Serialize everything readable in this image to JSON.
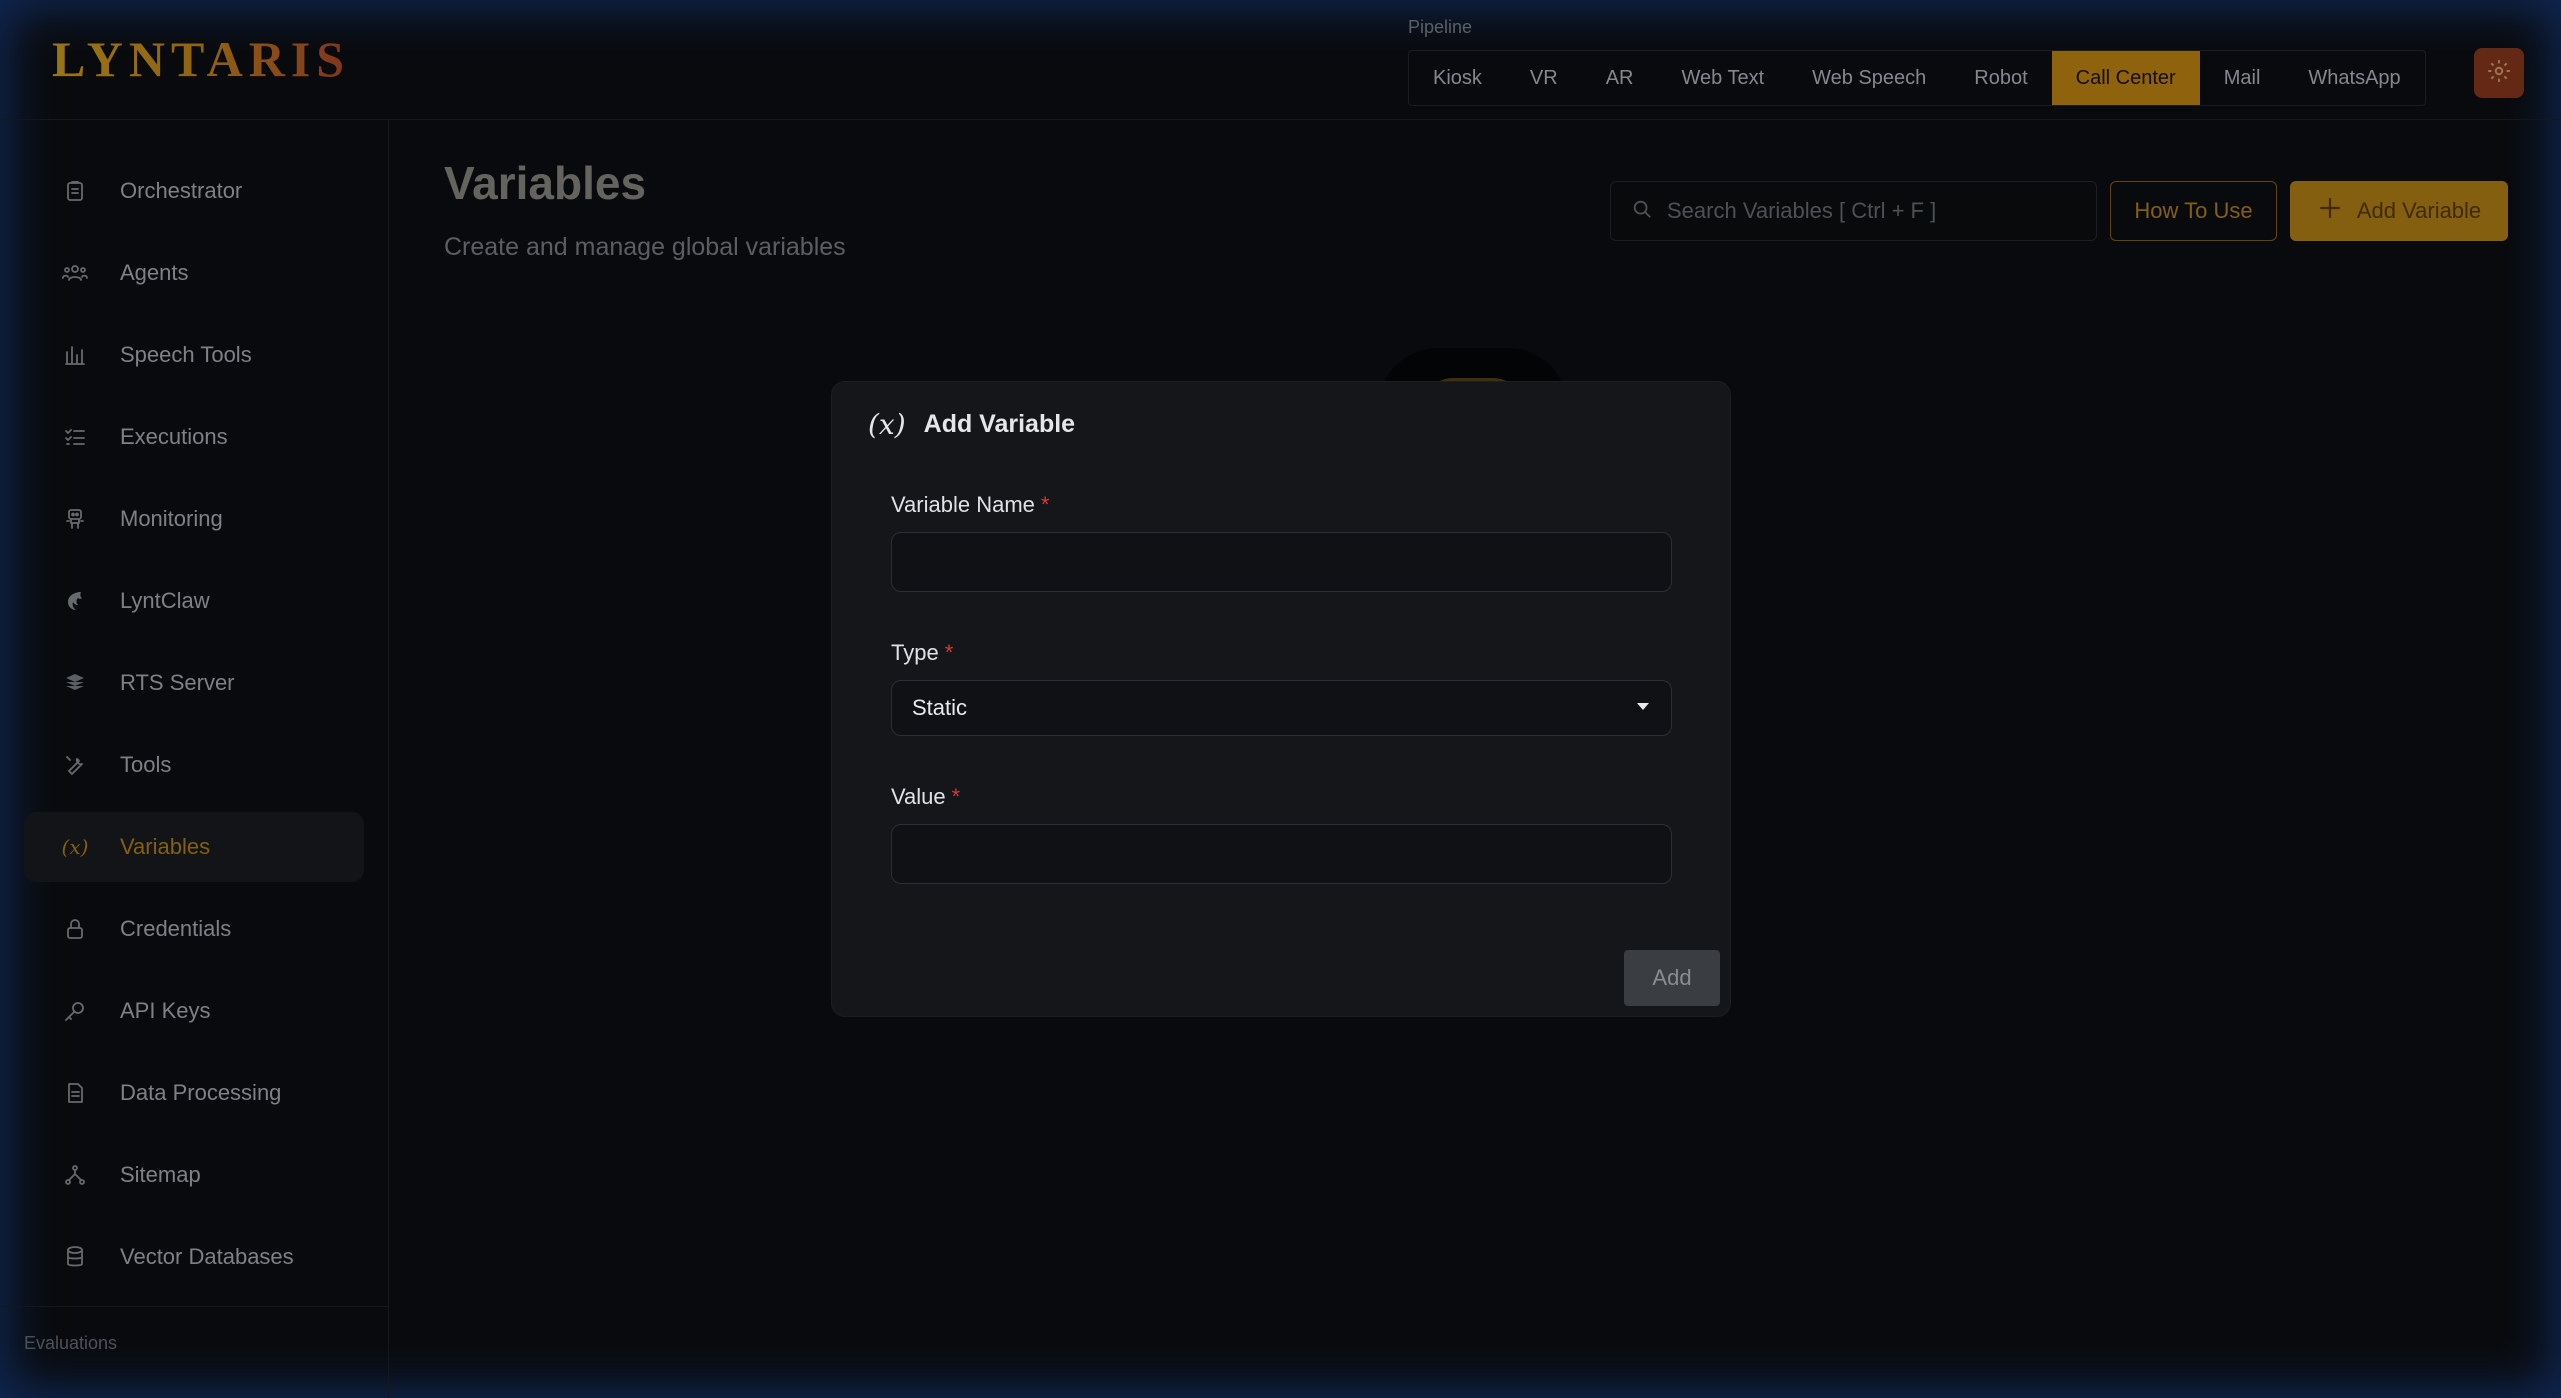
{
  "brand": {
    "logo_text": "LYNTARIS",
    "accent": "#c68a14"
  },
  "header": {
    "pipeline_label": "Pipeline",
    "tabs": [
      {
        "label": "Kiosk",
        "active": false
      },
      {
        "label": "VR",
        "active": false
      },
      {
        "label": "AR",
        "active": false
      },
      {
        "label": "Web Text",
        "active": false
      },
      {
        "label": "Web Speech",
        "active": false
      },
      {
        "label": "Robot",
        "active": false
      },
      {
        "label": "Call Center",
        "active": true
      },
      {
        "label": "Mail",
        "active": false
      },
      {
        "label": "WhatsApp",
        "active": false
      }
    ],
    "settings_icon": "gear-icon"
  },
  "sidebar": {
    "items": [
      {
        "label": "Orchestrator",
        "icon": "clipboard-icon"
      },
      {
        "label": "Agents",
        "icon": "users-icon"
      },
      {
        "label": "Speech Tools",
        "icon": "bar-chart-icon"
      },
      {
        "label": "Executions",
        "icon": "list-check-icon"
      },
      {
        "label": "Monitoring",
        "icon": "robot-icon"
      },
      {
        "label": "LyntClaw",
        "icon": "claw-icon"
      },
      {
        "label": "RTS Server",
        "icon": "server-icon"
      },
      {
        "label": "Tools",
        "icon": "wrench-icon"
      },
      {
        "label": "Variables",
        "icon": "variable-icon",
        "active": true
      },
      {
        "label": "Credentials",
        "icon": "lock-icon"
      },
      {
        "label": "API Keys",
        "icon": "key-icon"
      },
      {
        "label": "Data Processing",
        "icon": "document-icon"
      },
      {
        "label": "Sitemap",
        "icon": "sitemap-icon"
      },
      {
        "label": "Vector Databases",
        "icon": "database-icon"
      }
    ],
    "section_label": "Evaluations"
  },
  "main": {
    "title": "Variables",
    "subtitle": "Create and manage global variables",
    "search_placeholder": "Search Variables [ Ctrl + F ]",
    "how_to_use_label": "How To Use",
    "add_variable_label": "Add Variable"
  },
  "modal": {
    "title_icon": "(x)",
    "title": "Add Variable",
    "name_label": "Variable Name",
    "name_value": "",
    "type_label": "Type",
    "type_value": "Static",
    "value_label": "Value",
    "value_value": "",
    "required_mark": "*",
    "add_label": "Add"
  }
}
